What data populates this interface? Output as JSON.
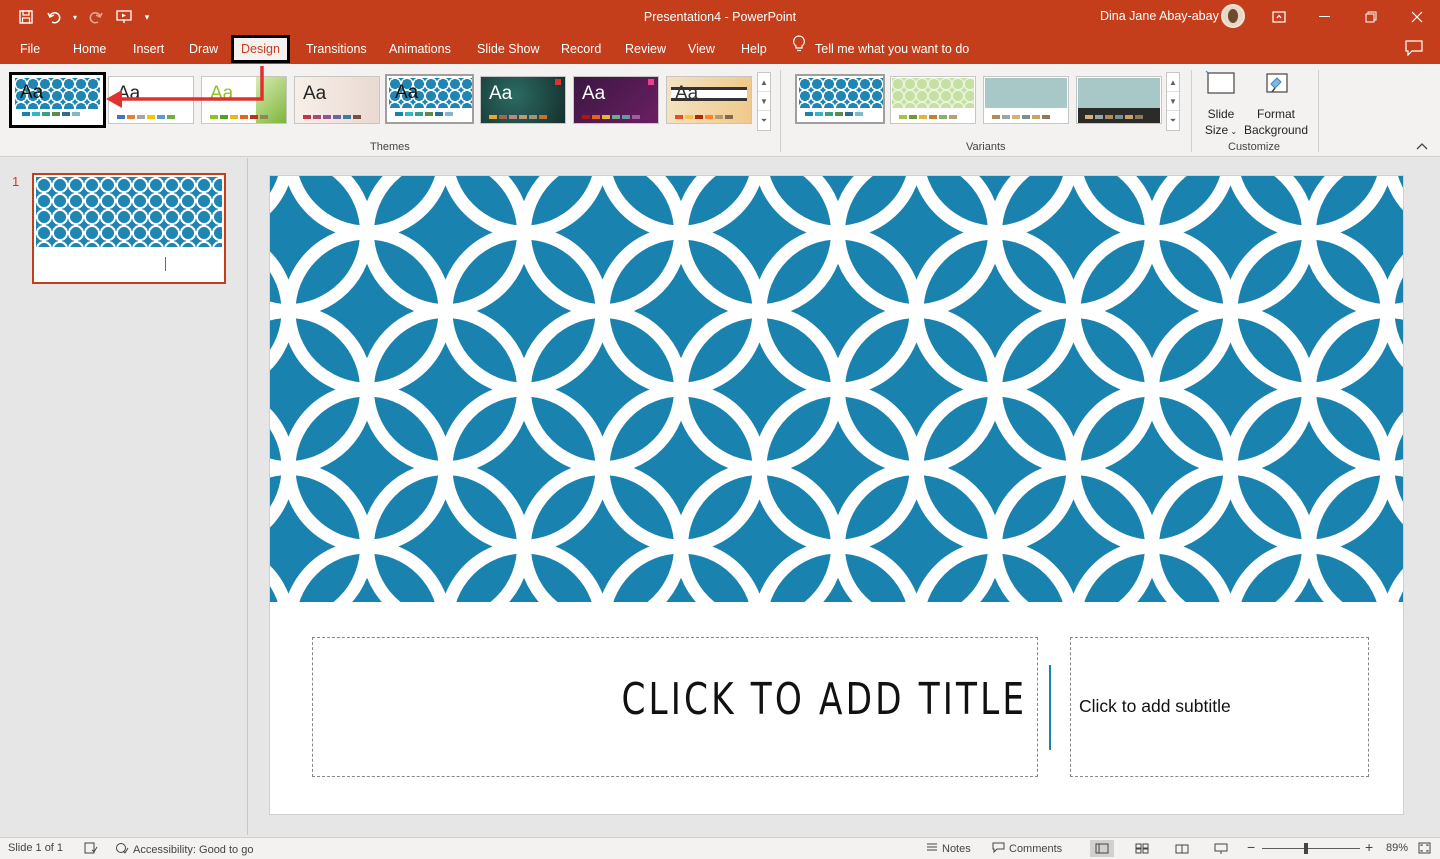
{
  "window": {
    "title": "Presentation4  -  PowerPoint",
    "user": "Dina Jane Abay-abay"
  },
  "tabs": [
    "File",
    "Home",
    "Insert",
    "Draw",
    "Design",
    "Transitions",
    "Animations",
    "Slide Show",
    "Record",
    "Review",
    "View",
    "Help"
  ],
  "active_tab": "Design",
  "tell_me": "Tell me what you want to do",
  "ribbon": {
    "themes_label": "Themes",
    "variants_label": "Variants",
    "customize_label": "Customize",
    "theme_sample_text": "Aa",
    "slide_size_line1": "Slide",
    "slide_size_line2": "Size",
    "format_bg_line1": "Format",
    "format_bg_line2": "Background"
  },
  "thumbnail": {
    "number": "1"
  },
  "slide": {
    "title_placeholder": "CLICK TO ADD TITLE",
    "subtitle_placeholder": "Click to add subtitle"
  },
  "status": {
    "slide_info": "Slide 1 of 1",
    "accessibility": "Accessibility: Good to go",
    "notes": "Notes",
    "comments": "Comments",
    "zoom_level": "89%",
    "zoom_fraction": 0.45
  },
  "colors": {
    "brand": "#c43e1c",
    "theme_blue": "#1a82ae",
    "annotation_red": "#e03131"
  }
}
